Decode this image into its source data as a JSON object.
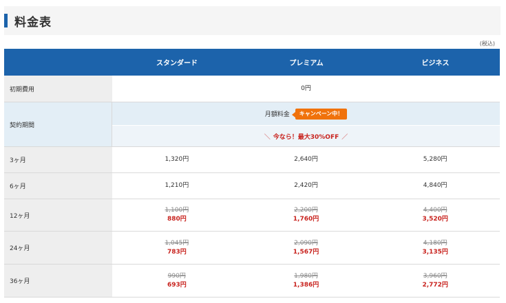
{
  "title": "料金表",
  "tax_note": "(税込)",
  "columns": [
    "スタンダード",
    "プレミアム",
    "ビジネス"
  ],
  "initial_fee": {
    "label": "初期費用",
    "value": "0円"
  },
  "contract": {
    "label": "契約期間",
    "monthly_label": "月額料金",
    "campaign_badge": "キャンペーン中！",
    "promo_left": "＼",
    "promo_text": "今なら！最大30%OFF",
    "promo_right": "／"
  },
  "plans": [
    {
      "label": "3ヶ月",
      "prices": [
        {
          "current": "1,320円"
        },
        {
          "current": "2,640円"
        },
        {
          "current": "5,280円"
        }
      ]
    },
    {
      "label": "6ヶ月",
      "prices": [
        {
          "current": "1,210円"
        },
        {
          "current": "2,420円"
        },
        {
          "current": "4,840円"
        }
      ]
    },
    {
      "label": "12ヶ月",
      "prices": [
        {
          "original": "1,100円",
          "discounted": "880円"
        },
        {
          "original": "2,200円",
          "discounted": "1,760円"
        },
        {
          "original": "4,400円",
          "discounted": "3,520円"
        }
      ]
    },
    {
      "label": "24ヶ月",
      "prices": [
        {
          "original": "1,045円",
          "discounted": "783円"
        },
        {
          "original": "2,090円",
          "discounted": "1,567円"
        },
        {
          "original": "4,180円",
          "discounted": "3,135円"
        }
      ]
    },
    {
      "label": "36ヶ月",
      "prices": [
        {
          "original": "990円",
          "discounted": "693円"
        },
        {
          "original": "1,980円",
          "discounted": "1,386円"
        },
        {
          "original": "3,960円",
          "discounted": "2,772円"
        }
      ]
    }
  ],
  "colors": {
    "header_blue": "#1c63ab",
    "discount_red": "#c8231e",
    "badge_orange": "#f0720c",
    "label_gray": "#eeeeee",
    "monthly_blue": "#e3eef6"
  }
}
